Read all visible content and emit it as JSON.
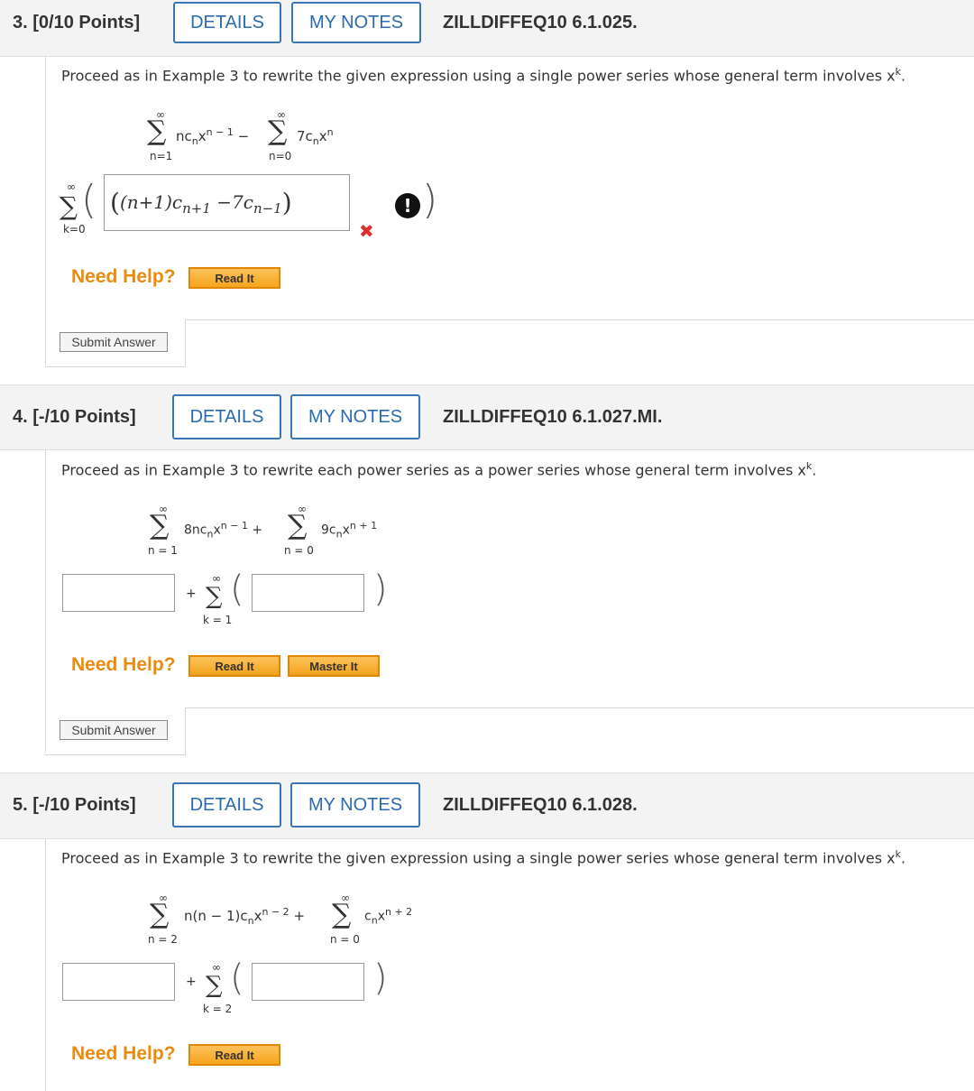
{
  "questions": [
    {
      "title": "3.  [0/10 Points]",
      "details_label": "DETAILS",
      "notes_label": "MY NOTES",
      "code": "ZILLDIFFEQ10 6.1.025.",
      "prompt": "Proceed as in Example 3 to rewrite the given expression using a single power series whose general term involves x",
      "prompt_sup": "k",
      "prompt_end": ".",
      "sum1_top": "∞",
      "sum1_bottom": "n=1",
      "sum2_top": "∞",
      "sum2_bottom": "n=0",
      "sum_k_top": "∞",
      "sum_k_bottom": "k=0",
      "answer_value": "((n+1)c_{n+1}−7c_{n−1})",
      "answer_status": "incorrect",
      "need_help": "Need Help?",
      "read_it": "Read It",
      "submit": "Submit Answer"
    },
    {
      "title": "4.  [-/10 Points]",
      "details_label": "DETAILS",
      "notes_label": "MY NOTES",
      "code": "ZILLDIFFEQ10 6.1.027.MI.",
      "prompt": "Proceed as in Example 3 to rewrite each power series as a power series whose general term involves x",
      "prompt_sup": "k",
      "prompt_end": ".",
      "sum1_top": "∞",
      "sum1_bottom": "n = 1",
      "sum2_top": "∞",
      "sum2_bottom": "n = 0",
      "sum_k_top": "∞",
      "sum_k_bottom": "k = 1",
      "answer_first": "",
      "answer_second": "",
      "need_help": "Need Help?",
      "read_it": "Read It",
      "master_it": "Master It",
      "submit": "Submit Answer"
    },
    {
      "title": "5.  [-/10 Points]",
      "details_label": "DETAILS",
      "notes_label": "MY NOTES",
      "code": "ZILLDIFFEQ10 6.1.028.",
      "prompt": "Proceed as in Example 3 to rewrite the given expression using a single power series whose general term involves x",
      "prompt_sup": "k",
      "prompt_end": ".",
      "sum1_top": "∞",
      "sum1_bottom": "n = 2",
      "sum2_top": "∞",
      "sum2_bottom": "n = 0",
      "sum_k_top": "∞",
      "sum_k_bottom": "k = 2",
      "answer_first": "",
      "answer_second": "",
      "need_help": "Need Help?",
      "read_it": "Read It"
    }
  ],
  "colors": {
    "accent": "#2a6bb0",
    "help_orange": "#e98b0c",
    "error_red": "#e0302c"
  }
}
